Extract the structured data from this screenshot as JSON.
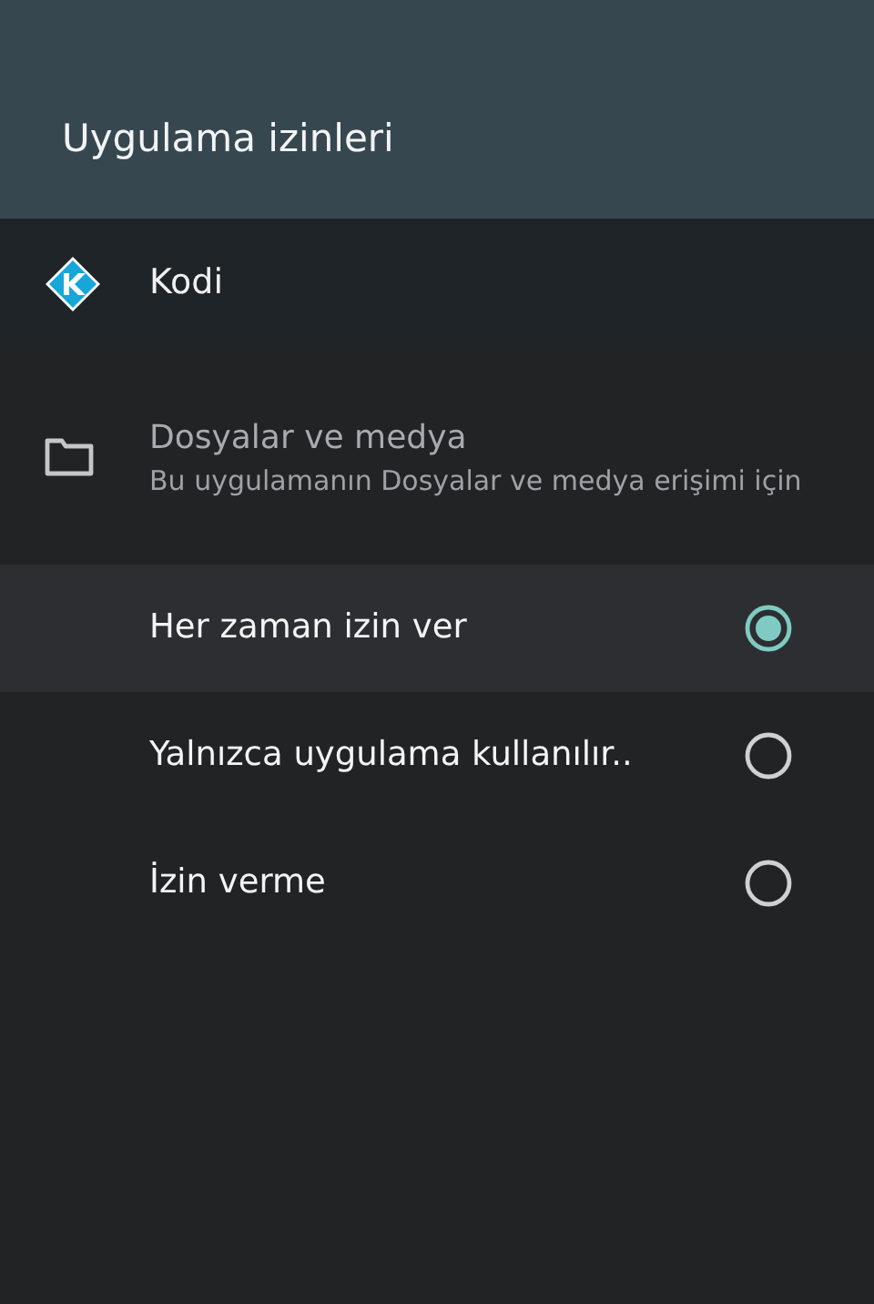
{
  "header": {
    "title": "Uygulama izinleri"
  },
  "app": {
    "name": "Kodi"
  },
  "permission": {
    "title": "Dosyalar ve medya",
    "description": "Bu uygulamanın Dosyalar ve medya erişimi için"
  },
  "options": [
    {
      "label": "Her zaman izin ver",
      "selected": true,
      "focused": true
    },
    {
      "label": "Yalnızca uygulama kullanılır..",
      "selected": false,
      "focused": false
    },
    {
      "label": "İzin verme",
      "selected": false,
      "focused": false
    }
  ]
}
